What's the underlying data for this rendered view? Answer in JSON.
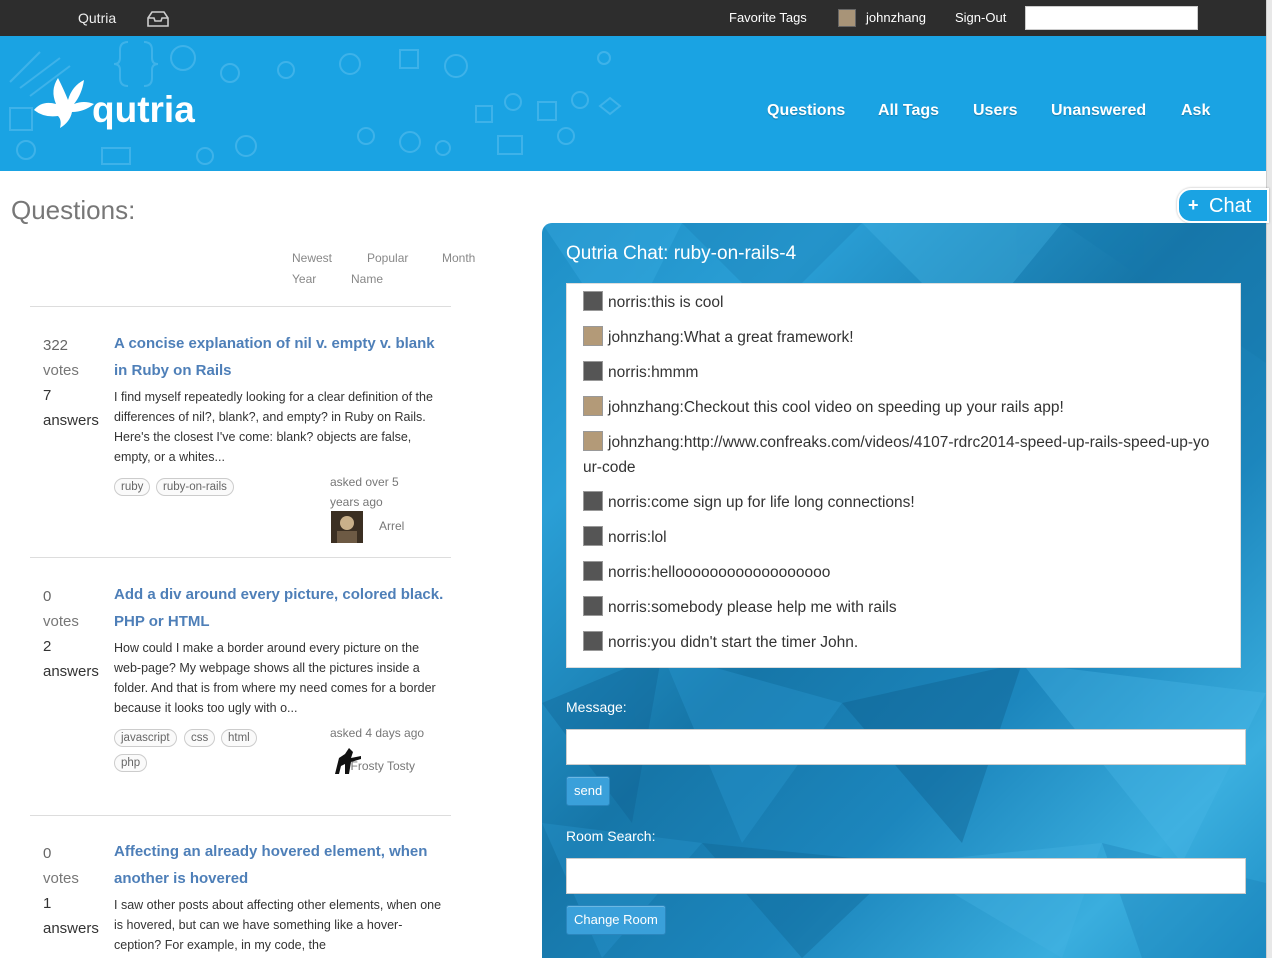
{
  "topbar": {
    "brand": "Qutria",
    "favorite_tags": "Favorite Tags",
    "username": "johnzhang",
    "sign_out": "Sign-Out",
    "search_value": ""
  },
  "banner": {
    "logo_text": "qutria",
    "nav": [
      "Questions",
      "All Tags",
      "Users",
      "Unanswered",
      "Ask"
    ]
  },
  "questions": {
    "heading": "Questions:",
    "sort_links": [
      "Newest",
      "Popular",
      "Month",
      "Year",
      "Name"
    ],
    "items": [
      {
        "votes": "322",
        "votes_label": "votes",
        "answers": "7",
        "answers_label": "answers",
        "title": "A concise explanation of nil v. empty v. blank in Ruby on Rails",
        "excerpt": "I find myself repeatedly looking for a clear definition of the differences of nil?, blank?, and empty? in Ruby on Rails. Here's the closest I've come: blank? objects are false, empty, or a whites...",
        "tags": [
          "ruby",
          "ruby-on-rails"
        ],
        "asked": "asked over 5 years ago",
        "author": "Arrel"
      },
      {
        "votes": "0",
        "votes_label": "votes",
        "answers": "2",
        "answers_label": "answers",
        "title": "Add a div around every picture, colored black. PHP or HTML",
        "excerpt": "How could I make a border around every picture on the web-page? My webpage shows all the pictures inside a folder. And that is from where my need comes for a border because it looks too ugly with o...",
        "tags": [
          "javascript",
          "css",
          "html",
          "php"
        ],
        "asked": "asked 4 days ago",
        "author": "Frosty Tosty"
      },
      {
        "votes": "0",
        "votes_label": "votes",
        "answers": "1",
        "answers_label": "answers",
        "title": "Affecting an already hovered element, when another is hovered",
        "excerpt": "I saw other posts about affecting other elements, when one is hovered, but can we have something like a hover-ception? For example, in my code, the"
      }
    ]
  },
  "chat": {
    "toggle_label": "Chat",
    "title": "Qutria Chat: ruby-on-rails-4",
    "messages": [
      {
        "user": "norris",
        "text": "norris:this is cool"
      },
      {
        "user": "johnzhang",
        "text": "johnzhang:What a great framework!"
      },
      {
        "user": "norris",
        "text": "norris:hmmm"
      },
      {
        "user": "johnzhang",
        "text": "johnzhang:Checkout this cool video on speeding up your rails app!"
      },
      {
        "user": "johnzhang",
        "text": "johnzhang:http://www.confreaks.com/videos/4107-rdrc2014-speed-up-rails-speed-up-your-code"
      },
      {
        "user": "norris",
        "text": "norris:come sign up for life long connections!"
      },
      {
        "user": "norris",
        "text": "norris:lol"
      },
      {
        "user": "norris",
        "text": "norris:helloooooooooooooooooo"
      },
      {
        "user": "norris",
        "text": "norris:somebody please help me with rails"
      },
      {
        "user": "norris",
        "text": "norris:you didn't start the timer John."
      }
    ],
    "message_label": "Message:",
    "message_value": "",
    "send_label": "send",
    "room_search_label": "Room Search:",
    "room_search_value": "",
    "change_room_label": "Change Room"
  },
  "colors": {
    "topbar_bg": "#2d2d2d",
    "banner_bg": "#1aa3e3",
    "link": "#4e7fb8",
    "chat_bg": "#1c86bd",
    "button": "#3aa0da"
  },
  "icons": [
    "inbox-icon",
    "logo-wings-icon",
    "plus-icon"
  ]
}
